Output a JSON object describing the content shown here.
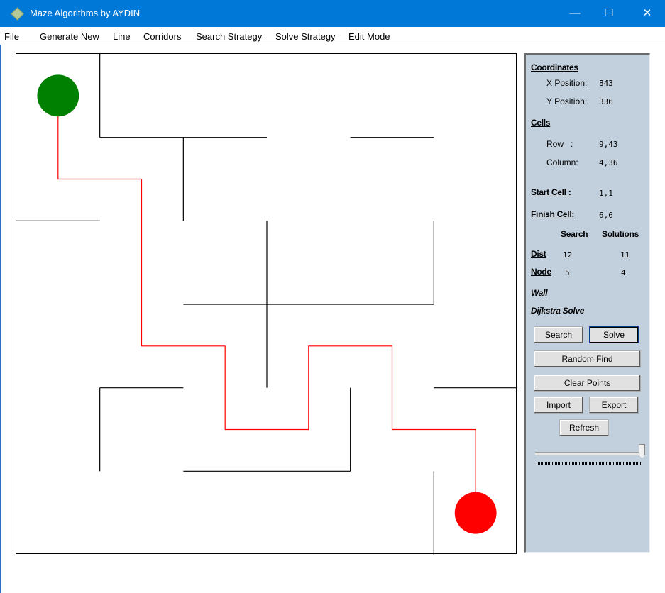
{
  "window": {
    "title": "Maze Algorithms by AYDIN",
    "minimize_glyph": "—",
    "maximize_glyph": "☐",
    "close_glyph": "✕"
  },
  "menu": [
    "File",
    "Generate New",
    "Line",
    "Corridors",
    "Search Strategy",
    "Solve Strategy",
    "Edit Mode"
  ],
  "maze": {
    "rows": 6,
    "cols": 6,
    "start": [
      1,
      1
    ],
    "finish": [
      6,
      6
    ],
    "start_color": "#008000",
    "finish_color": "#ff0000",
    "path_color": "#ff0000",
    "wall_color": "#000000",
    "walls": [
      {
        "o": "v",
        "line": 1,
        "from": 0,
        "to": 1
      },
      {
        "o": "h",
        "line": 1,
        "from": 1,
        "to": 3
      },
      {
        "o": "h",
        "line": 1,
        "from": 4,
        "to": 5
      },
      {
        "o": "v",
        "line": 2,
        "from": 1,
        "to": 2
      },
      {
        "o": "h",
        "line": 2,
        "from": 0,
        "to": 1
      },
      {
        "o": "v",
        "line": 3,
        "from": 2,
        "to": 4
      },
      {
        "o": "v",
        "line": 5,
        "from": 2,
        "to": 3
      },
      {
        "o": "h",
        "line": 3,
        "from": 2,
        "to": 5
      },
      {
        "o": "h",
        "line": 4,
        "from": 1,
        "to": 2
      },
      {
        "o": "h",
        "line": 4,
        "from": 5,
        "to": 6
      },
      {
        "o": "v",
        "line": 1,
        "from": 4,
        "to": 5
      },
      {
        "o": "v",
        "line": 4,
        "from": 4,
        "to": 5
      },
      {
        "o": "h",
        "line": 5,
        "from": 2,
        "to": 4
      },
      {
        "o": "v",
        "line": 5,
        "from": 5,
        "to": 6
      }
    ],
    "solution_path": [
      [
        0.5,
        0.5
      ],
      [
        0.5,
        1.5
      ],
      [
        1.5,
        1.5
      ],
      [
        1.5,
        3.5
      ],
      [
        2.5,
        3.5
      ],
      [
        2.5,
        4.5
      ],
      [
        3.5,
        4.5
      ],
      [
        3.5,
        3.5
      ],
      [
        4.5,
        3.5
      ],
      [
        4.5,
        4.5
      ],
      [
        5.5,
        4.5
      ],
      [
        5.5,
        5.5
      ]
    ]
  },
  "panel": {
    "coordinates_title": "Coordinates",
    "x_label": "X Position:",
    "x_value": "843",
    "y_label": "Y Position:",
    "y_value": "336",
    "cells_title": "Cells",
    "row_label": "Row   :",
    "row_value": "9,43",
    "col_label": "Column:",
    "col_value": "4,36",
    "start_label": "Start Cell :",
    "start_value": "1,1",
    "finish_label": "Finish Cell:",
    "finish_value": "6,6",
    "search_header": "Search",
    "solutions_header": "Solutions",
    "dist_label": "Dist",
    "dist_search": "12",
    "dist_solution": "11",
    "node_label": "Node",
    "node_search": "5",
    "node_solution": "4",
    "mode_text": "Wall",
    "solve_text": "Dijkstra Solve",
    "btn_search": "Search",
    "btn_solve": "Solve",
    "btn_random": "Random Find",
    "btn_clear": "Clear Points",
    "btn_import": "Import",
    "btn_export": "Export",
    "btn_refresh": "Refresh",
    "speed_slider_fraction": 1.0,
    "background_color": "#c2d0de"
  }
}
